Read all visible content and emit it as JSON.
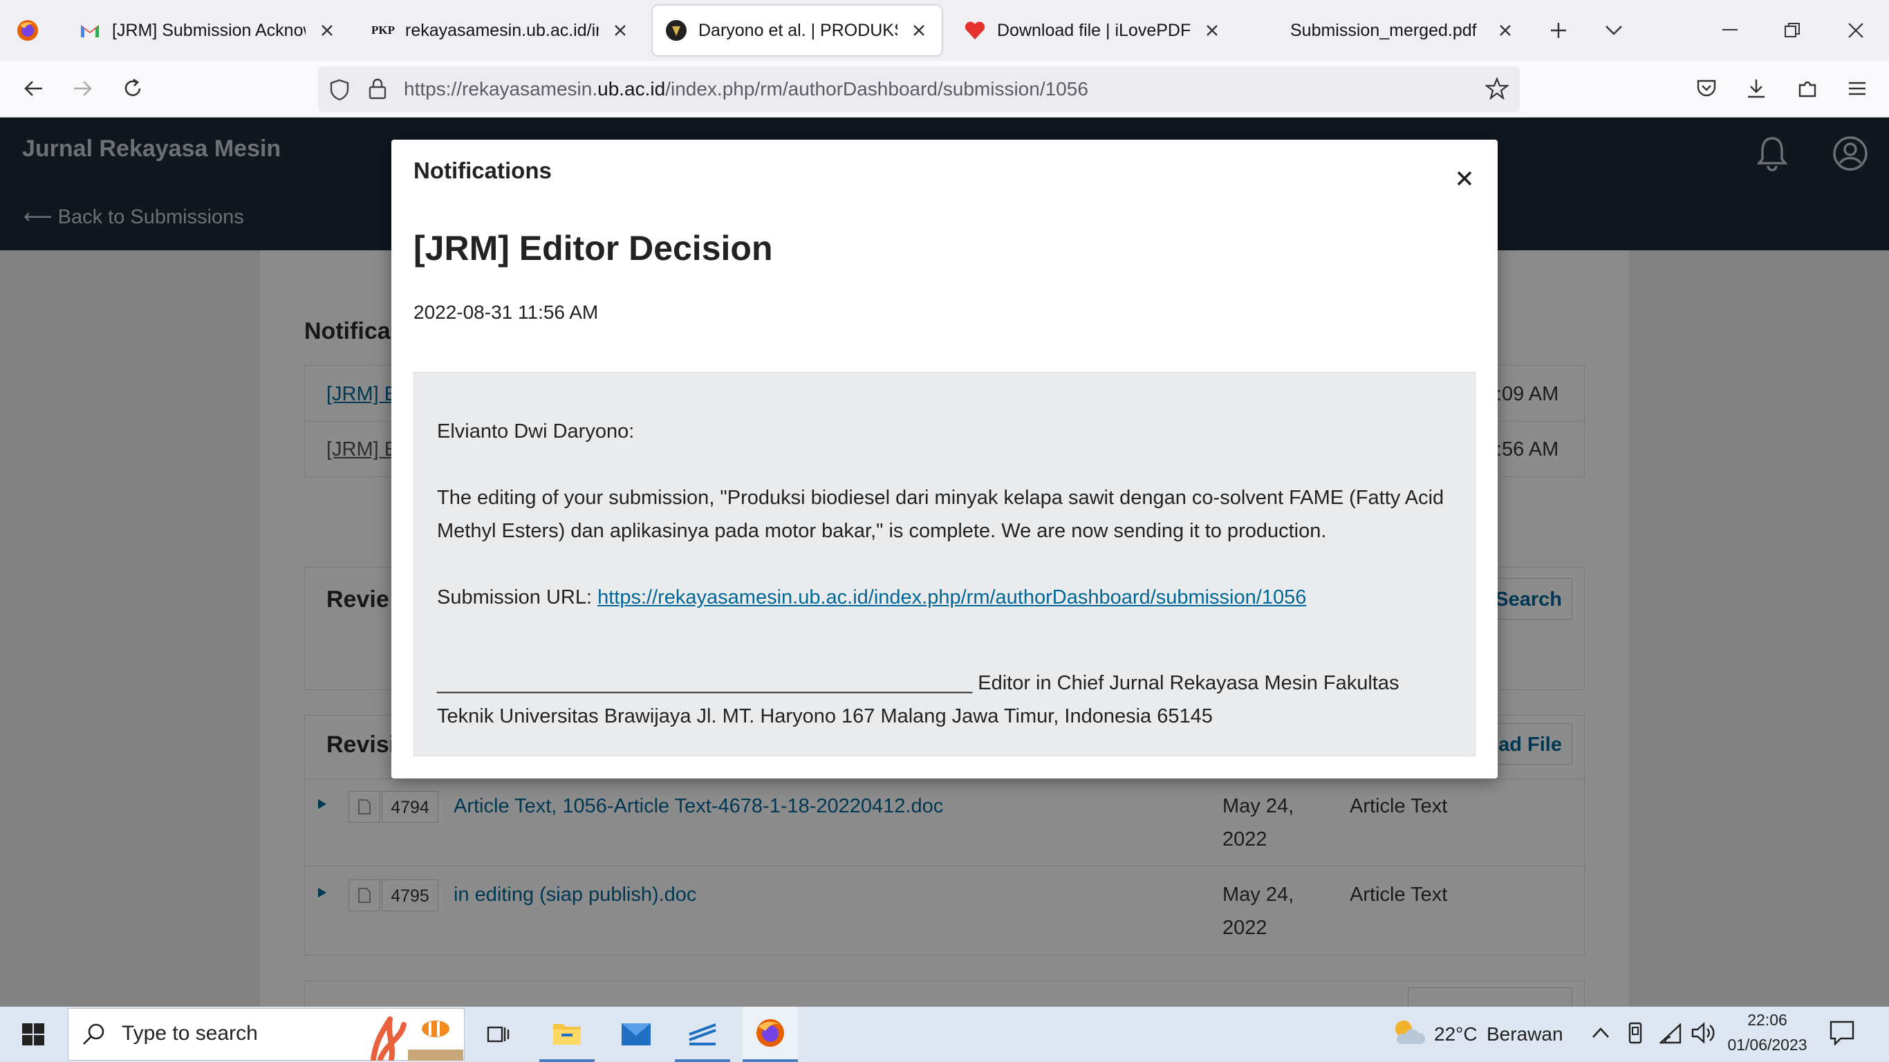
{
  "browser": {
    "tabs": [
      {
        "title": "[JRM] Submission Acknowled",
        "icon": "gmail-icon"
      },
      {
        "title": "rekayasamesin.ub.ac.id/inde",
        "icon_text": "PKP"
      },
      {
        "title": "Daryono et al. | PRODUKSI BI",
        "icon": "journal-logo-icon"
      },
      {
        "title": "Download file | iLovePDF",
        "icon": "heart-icon"
      },
      {
        "title": "Submission_merged.pdf"
      }
    ],
    "url_prefix": "https://rekayasamesin.",
    "url_domain": "ub.ac.id",
    "url_suffix": "/index.php/rm/authorDashboard/submission/1056"
  },
  "site": {
    "title": "Jurnal Rekayasa Mesin",
    "back_link": "⟵ Back to Submissions"
  },
  "page": {
    "notifications_heading": "Notifica",
    "notif_rows": [
      {
        "left": "[JRM] E",
        "right": ":09 AM"
      },
      {
        "left": "[JRM] E",
        "right": ":56 AM"
      }
    ],
    "review_heading": "Revie",
    "search_label": "Search",
    "revisions_heading": "Revisi",
    "upload_label": "ad File",
    "files": [
      {
        "id": "4794",
        "name": "Article Text, 1056-Article Text-4678-1-18-20220412.doc",
        "date_line1": "May 24,",
        "date_line2": "2022",
        "type": "Article Text"
      },
      {
        "id": "4795",
        "name": "in editing (siap publish).doc",
        "date_line1": "May 24,",
        "date_line2": "2022",
        "type": "Article Text"
      }
    ]
  },
  "modal": {
    "title": "Notifications",
    "notice_title": "[JRM] Editor Decision",
    "notice_date": "2022-08-31 11:56 AM",
    "greeting": "Elvianto Dwi Daryono:",
    "body": "The editing of your submission, \"Produksi biodiesel dari minyak kelapa sawit dengan co-solvent FAME (Fatty Acid Methyl Esters) dan aplikasinya pada motor bakar,\" is complete. We are now sending it to production.",
    "url_label": "Submission URL: ",
    "url": "https://rekayasamesin.ub.ac.id/index.php/rm/authorDashboard/submission/1056",
    "signature": "________________________________________________ Editor in Chief Jurnal Rekayasa Mesin Fakultas Teknik Universitas Brawijaya Jl. MT. Haryono 167 Malang Jawa Timur, Indonesia 65145"
  },
  "taskbar": {
    "search_placeholder": "Type to search",
    "weather_temp": "22°C",
    "weather_desc": "Berawan",
    "time": "22:06",
    "date": "01/06/2023"
  },
  "colors": {
    "header": "#1e2b3a",
    "link": "#006798",
    "taskbar": "#dde6f1"
  }
}
